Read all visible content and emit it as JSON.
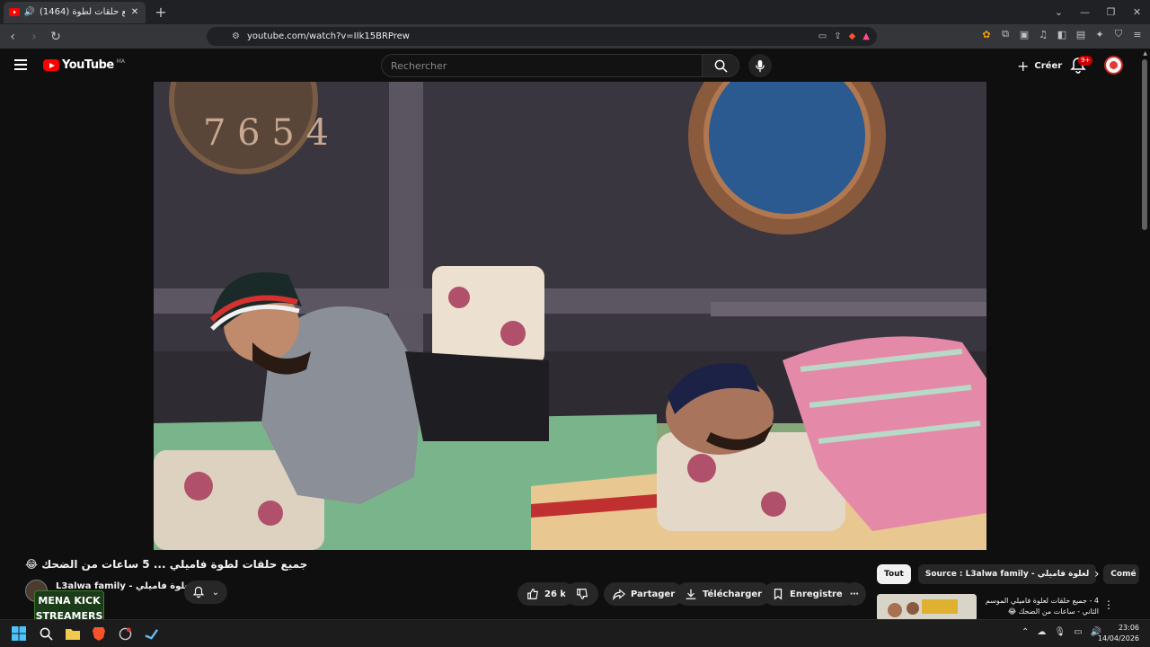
{
  "browser": {
    "tab_title": "(1464) جميع حلقات لطوة 🥰",
    "url": "youtube.com/watch?v=IIk15BRPrew"
  },
  "youtube": {
    "region": "MA",
    "search_placeholder": "Rechercher",
    "create_label": "Créer",
    "notif_count": "9+"
  },
  "video": {
    "title": "جميع حلقات لطوة فاميلي ... 5 ساعات من الضحك 😂",
    "channel": "L3alwa family - لعلوة فاميلي",
    "likes": "26 k",
    "share": "Partager",
    "download": "Télécharger",
    "save": "Enregistrer"
  },
  "watermark": {
    "line1": "MENA KICK",
    "line2": "STREAMERS"
  },
  "chips": [
    "Tout",
    "Source : L3alwa family - لعلوة فاميلي",
    "Comé"
  ],
  "recommendation": {
    "title": "4 - جميع حلقات لعلوة فاميلي الموسم الثاني - ساعات من الضحك 😂"
  },
  "taskbar": {
    "time": "23:06",
    "date": "14/04/2026"
  }
}
